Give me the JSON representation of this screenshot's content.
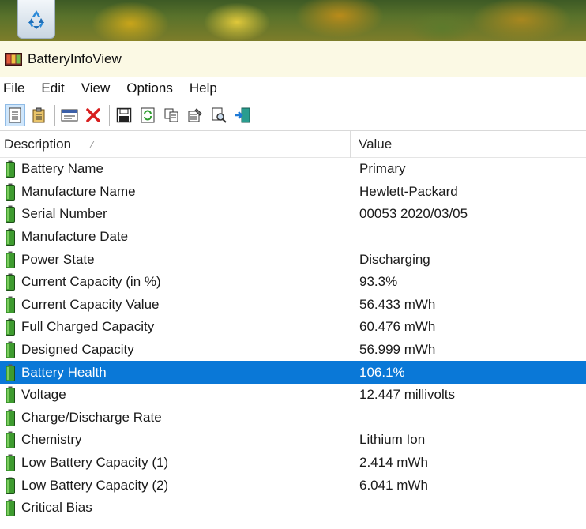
{
  "desktop": {
    "recycle_bin_icon": "recycle-bin-icon"
  },
  "window": {
    "title": "BatteryInfoView",
    "app_icon": "battery-app-icon"
  },
  "menu": {
    "items": [
      "File",
      "Edit",
      "View",
      "Options",
      "Help"
    ]
  },
  "toolbar": {
    "buttons": [
      "properties-view-icon",
      "clipboard-view-icon",
      "window-icon",
      "delete-icon",
      "save-icon",
      "refresh-icon",
      "copy-icon",
      "properties-icon",
      "find-icon",
      "exit-icon"
    ]
  },
  "columns": {
    "description": "Description",
    "value": "Value"
  },
  "rows": [
    {
      "description": "Battery Name",
      "value": "Primary"
    },
    {
      "description": "Manufacture Name",
      "value": "Hewlett-Packard"
    },
    {
      "description": "Serial Number",
      "value": "00053 2020/03/05"
    },
    {
      "description": "Manufacture Date",
      "value": ""
    },
    {
      "description": "Power State",
      "value": "Discharging"
    },
    {
      "description": "Current Capacity (in %)",
      "value": "93.3%"
    },
    {
      "description": "Current Capacity Value",
      "value": "56.433 mWh"
    },
    {
      "description": "Full Charged Capacity",
      "value": "60.476 mWh"
    },
    {
      "description": "Designed Capacity",
      "value": "56.999 mWh"
    },
    {
      "description": "Battery Health",
      "value": "106.1%"
    },
    {
      "description": "Voltage",
      "value": "12.447 millivolts"
    },
    {
      "description": "Charge/Discharge Rate",
      "value": ""
    },
    {
      "description": "Chemistry",
      "value": "Lithium Ion"
    },
    {
      "description": "Low Battery Capacity (1)",
      "value": "2.414 mWh"
    },
    {
      "description": "Low Battery Capacity (2)",
      "value": "6.041 mWh"
    },
    {
      "description": "Critical Bias",
      "value": ""
    }
  ],
  "selected_row": 9,
  "colors": {
    "selection": "#0a78d7",
    "titlebar": "#fbf9e4",
    "battery_green": "#3e9b2f"
  }
}
